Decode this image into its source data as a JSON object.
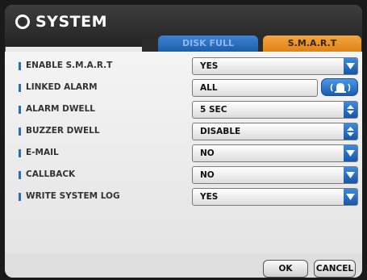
{
  "window": {
    "title": "SYSTEM",
    "icon": "gear-icon"
  },
  "tabs": [
    {
      "label": "DISK FULL",
      "active": false
    },
    {
      "label": "S.M.A.R.T",
      "active": true
    }
  ],
  "rows": [
    {
      "label": "ENABLE S.M.A.R.T",
      "value": "YES",
      "control": "dropdown"
    },
    {
      "label": "LINKED ALARM",
      "value": "ALL",
      "control": "alarm-button"
    },
    {
      "label": "ALARM DWELL",
      "value": "5 SEC",
      "control": "spinner"
    },
    {
      "label": "BUZZER DWELL",
      "value": "DISABLE",
      "control": "spinner"
    },
    {
      "label": "E-MAIL",
      "value": "NO",
      "control": "dropdown"
    },
    {
      "label": "CALLBACK",
      "value": "NO",
      "control": "dropdown"
    },
    {
      "label": "WRITE SYSTEM LOG",
      "value": "YES",
      "control": "dropdown"
    }
  ],
  "buttons": {
    "ok": "OK",
    "cancel": "CANCEL"
  },
  "colors": {
    "accent_blue": "#1f6fd1",
    "tab_active_orange": "#f0962c",
    "title_bar": "#2d2d2d"
  }
}
